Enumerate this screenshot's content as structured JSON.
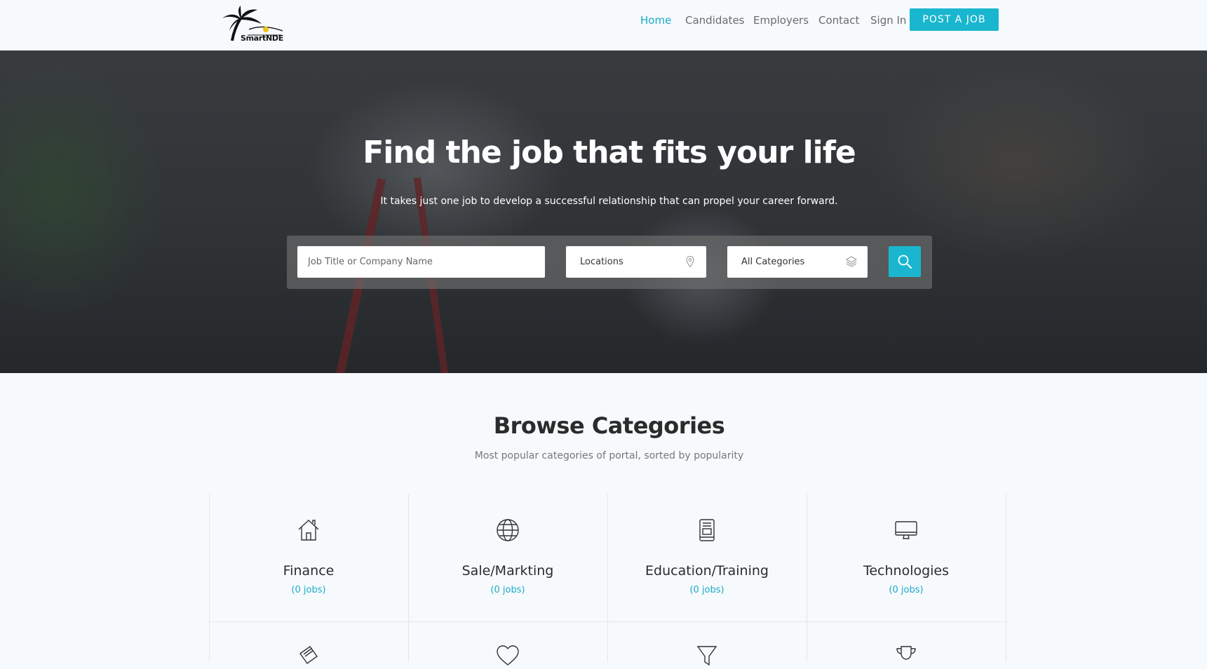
{
  "brand": {
    "name": "SmartNDE"
  },
  "nav": {
    "items": [
      {
        "label": "Home",
        "active": true
      },
      {
        "label": "Candidates",
        "active": false
      },
      {
        "label": "Employers",
        "active": false
      },
      {
        "label": "Contact",
        "active": false
      },
      {
        "label": "Sign In",
        "active": false
      }
    ],
    "post_job_label": "POST A JOB"
  },
  "hero": {
    "title": "Find the job that fits your life",
    "subtitle": "It takes just one job to develop a successful relationship that can propel your career forward."
  },
  "search": {
    "keyword_placeholder": "Job Title or Company Name",
    "location_label": "Locations",
    "category_label": "All Categories"
  },
  "categories_section": {
    "title": "Browse Categories",
    "subtitle": "Most popular categories of portal, sorted by popularity",
    "items": [
      {
        "name": "Finance",
        "count": "(0 jobs)",
        "icon": "house-icon"
      },
      {
        "name": "Sale/Markting",
        "count": "(0 jobs)",
        "icon": "globe-icon"
      },
      {
        "name": "Education/Training",
        "count": "(0 jobs)",
        "icon": "book-icon"
      },
      {
        "name": "Technologies",
        "count": "(0 jobs)",
        "icon": "monitor-icon"
      }
    ],
    "partial_row_icons": [
      "ticket-icon",
      "heart-icon",
      "filter-icon",
      "trophy-icon"
    ]
  },
  "colors": {
    "accent": "#1ab6cf",
    "link": "#1ba9c8",
    "text_dark": "#2b2b2b"
  }
}
